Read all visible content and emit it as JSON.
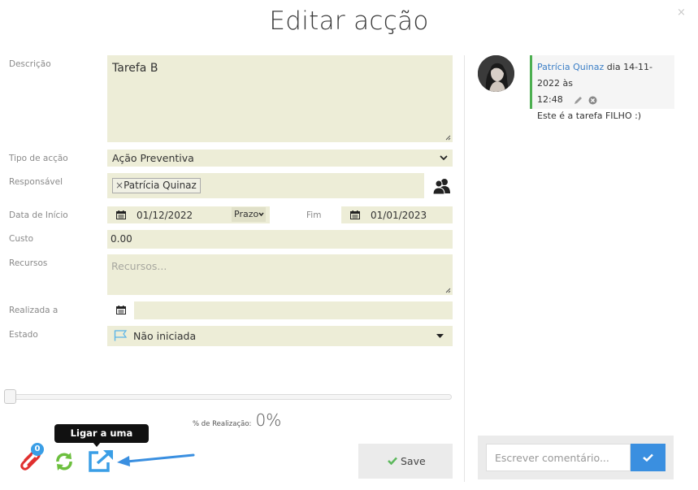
{
  "dialog": {
    "title": "Editar acção",
    "close_label": "×"
  },
  "form": {
    "descricao": {
      "label": "Descrição",
      "value": "Tarefa B"
    },
    "tipo": {
      "label": "Tipo de acção",
      "value": "Ação Preventiva"
    },
    "responsavel": {
      "label": "Responsável",
      "tag": "Patrícia Quinaz",
      "tag_remove": "×"
    },
    "data_inicio": {
      "label": "Data de Início",
      "value": "01/12/2022",
      "prazo_label": "Prazo"
    },
    "fim": {
      "label": "Fim",
      "value": "01/01/2023"
    },
    "custo": {
      "label": "Custo",
      "value": "0.00"
    },
    "recursos": {
      "label": "Recursos",
      "placeholder": "Recursos..."
    },
    "realizada": {
      "label": "Realizada a",
      "value": ""
    },
    "estado": {
      "label": "Estado",
      "value": "Não iniciada"
    }
  },
  "progress": {
    "label": "% de Realização:",
    "value_text": "0%",
    "value": 0
  },
  "toolbar": {
    "attachments_count": "0",
    "tooltip": "Ligar a uma acção",
    "save_label": "Save"
  },
  "comments": [
    {
      "author": "Patrícia Quinaz",
      "meta": "dia 14-11-2022 às",
      "time": "12:48",
      "text": "Este é a tarefa FILHO :)"
    }
  ],
  "comment_input": {
    "placeholder": "Escrever comentário..."
  },
  "colors": {
    "field_bg": "#ededd7",
    "accent_blue": "#3a8fe0",
    "comment_bar": "#4caf50",
    "attach_red": "#e0302f",
    "sync_green": "#6cbf3e"
  }
}
